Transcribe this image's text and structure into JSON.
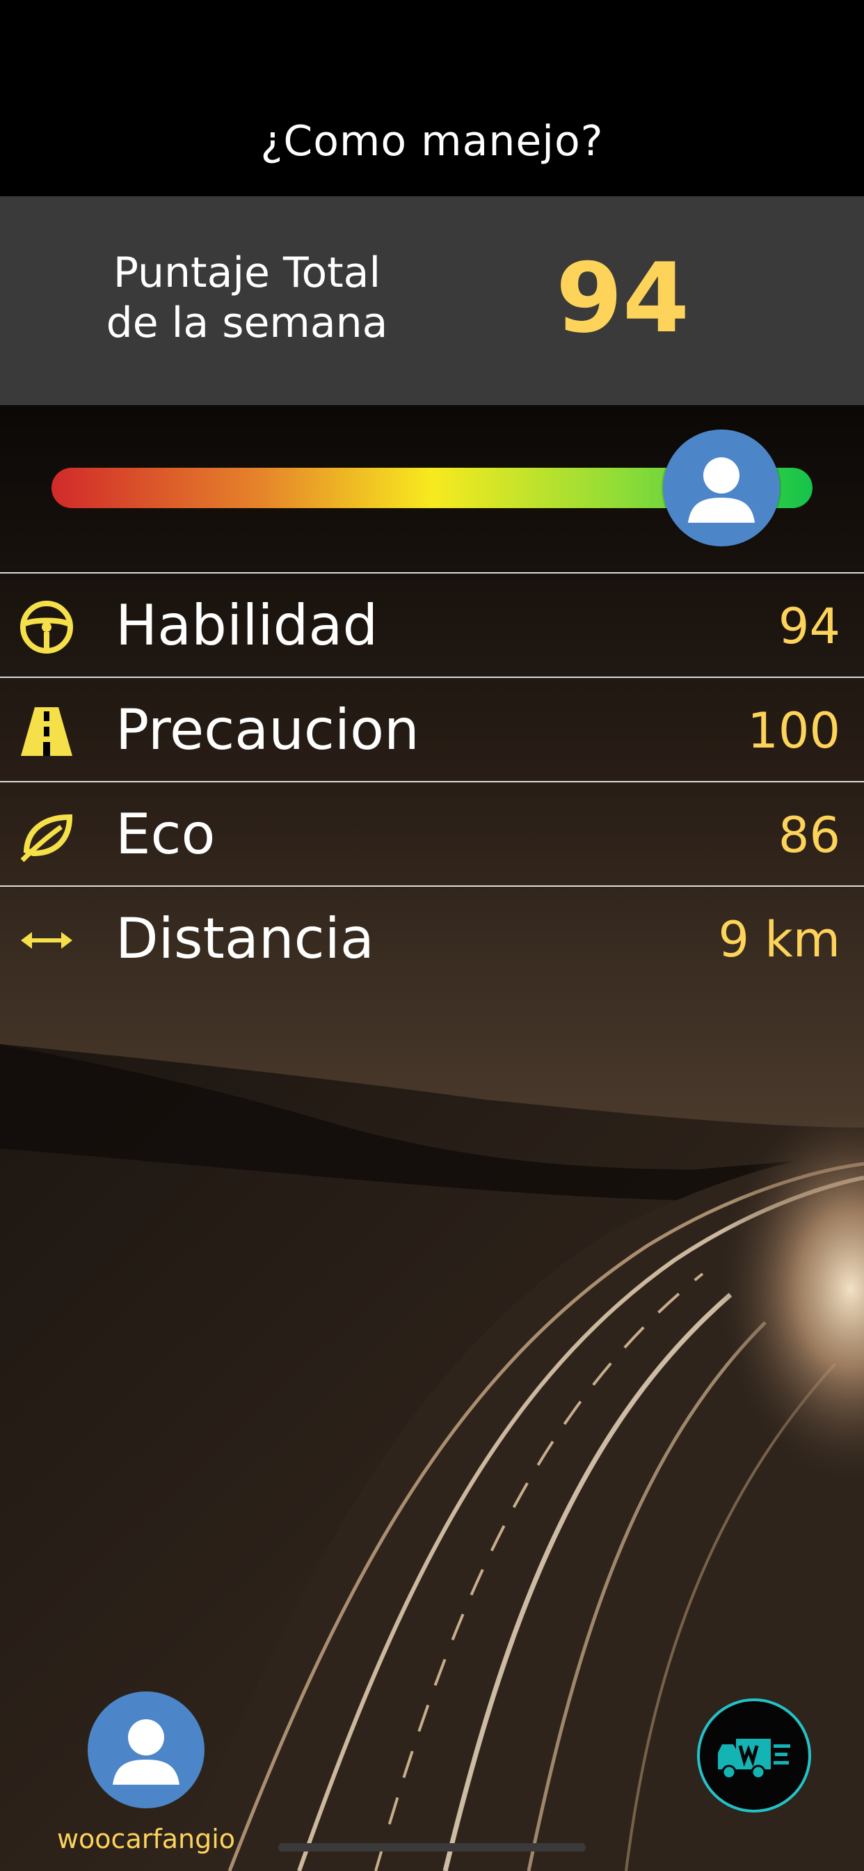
{
  "header": {
    "title": "¿Como manejo?"
  },
  "score": {
    "label_line1": "Puntaje Total",
    "label_line2": "de la semana",
    "value": "94"
  },
  "gauge": {
    "level": 0.88
  },
  "metrics": [
    {
      "icon": "steering-wheel-icon",
      "label": "Habilidad",
      "value": "94"
    },
    {
      "icon": "road-icon",
      "label": "Precaucion",
      "value": "100"
    },
    {
      "icon": "leaf-icon",
      "label": "Eco",
      "value": "86"
    },
    {
      "icon": "distance-arrows-icon",
      "label": "Distancia",
      "value": "9 km"
    }
  ],
  "user": {
    "username": "woocarfangio"
  },
  "colors": {
    "accent": "#fdd35a",
    "avatar": "#4c86c9",
    "panel": "#3a3a3a",
    "truck_ring": "#22c3c8"
  }
}
